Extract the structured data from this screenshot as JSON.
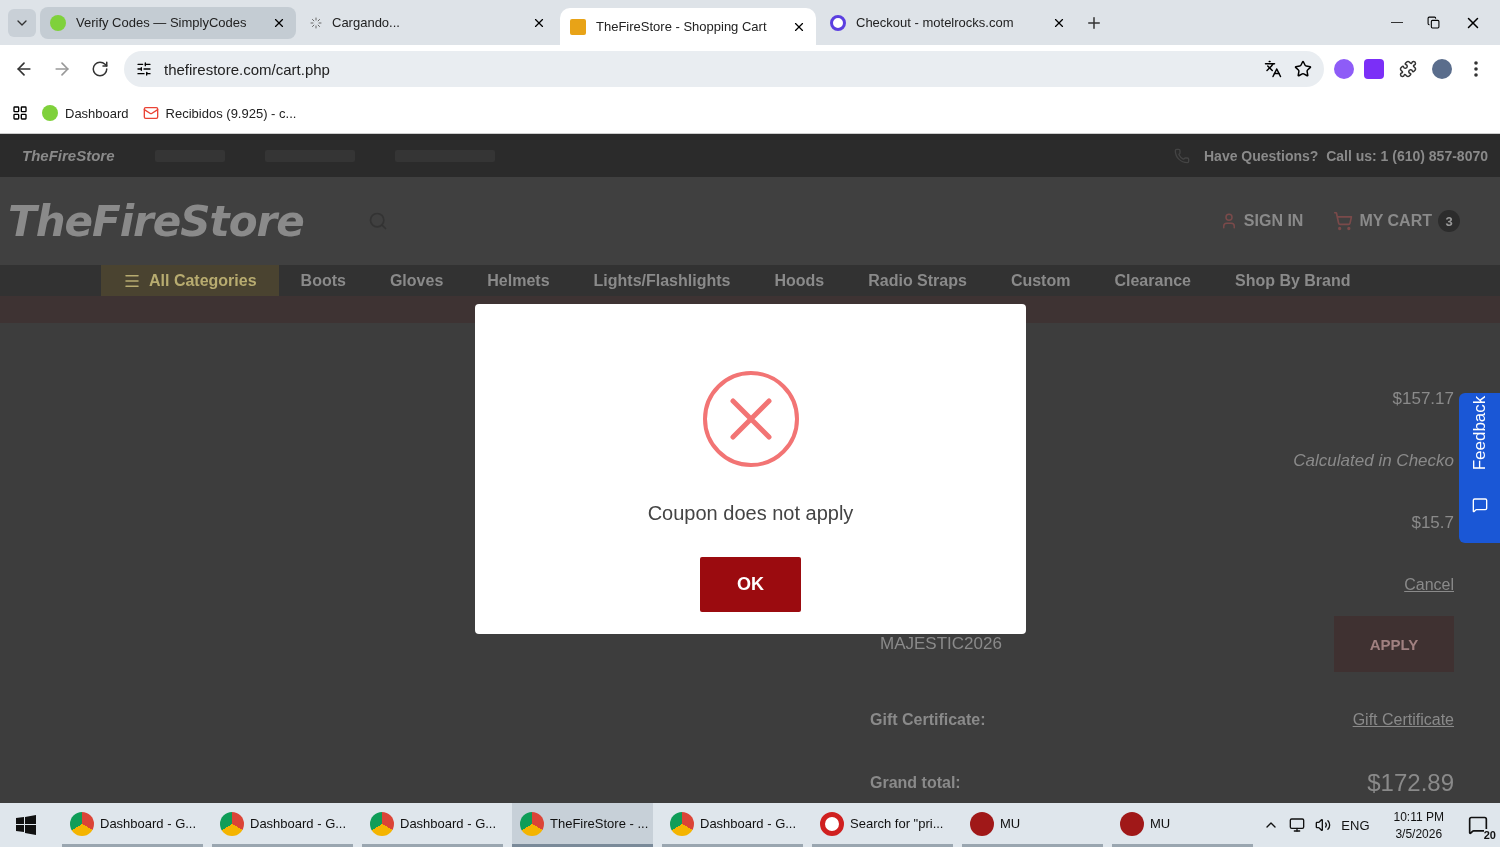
{
  "browser": {
    "tabs": [
      {
        "title": "Verify Codes — SimplyCodes",
        "selected": false,
        "kind": "simply"
      },
      {
        "title": "Cargando...",
        "selected": false,
        "kind": "loading"
      },
      {
        "title": "TheFireStore - Shopping Cart",
        "selected": true,
        "kind": "fire"
      },
      {
        "title": "Checkout - motelrocks.com",
        "selected": false,
        "kind": "ring"
      }
    ],
    "url": "thefirestore.com/cart.php",
    "bookmarks": [
      {
        "label": "Dashboard",
        "kind": "simply"
      },
      {
        "label": "Recibidos (9.925) - c...",
        "kind": "mail"
      }
    ]
  },
  "page": {
    "topbar": {
      "brand": "TheFireStore",
      "phone": "Have Questions?  Call us: 1 (610) 857-8070"
    },
    "header": {
      "logo": "TheFireStore",
      "sign_in": "SIGN IN",
      "cart": "MY CART",
      "cart_count": "3"
    },
    "nav": [
      {
        "label": "All Categories",
        "selected": true
      },
      {
        "label": "Boots",
        "selected": false
      },
      {
        "label": "Gloves",
        "selected": false
      },
      {
        "label": "Helmets",
        "selected": false
      },
      {
        "label": "Lights/Flashlights",
        "selected": false
      },
      {
        "label": "Hoods",
        "selected": false
      },
      {
        "label": "Radio Straps",
        "selected": false
      },
      {
        "label": "Custom",
        "selected": false
      },
      {
        "label": "Clearance",
        "selected": false
      },
      {
        "label": "Shop By Brand",
        "selected": false
      }
    ],
    "summary": [
      {
        "kind": "value",
        "value": "$157.17"
      },
      {
        "kind": "note",
        "value": "Calculated in Checko"
      },
      {
        "kind": "value",
        "value": "$15.7"
      },
      {
        "kind": "link",
        "value": "Cancel"
      },
      {
        "kind": "coupon",
        "code": "MAJESTIC2026",
        "button": "APPLY"
      },
      {
        "kind": "labeled_link",
        "label": "Gift Certificate:",
        "value": "Gift Certificate"
      },
      {
        "kind": "total",
        "label": "Grand total:",
        "value": "$172.89"
      }
    ],
    "feedback": "Feedback",
    "modal": {
      "message": "Coupon does not apply",
      "button": "OK"
    }
  },
  "taskbar": {
    "items": [
      {
        "label": "Dashboard - G...",
        "selected": false,
        "kind": "chrome"
      },
      {
        "label": "Dashboard - G...",
        "selected": false,
        "kind": "chrome"
      },
      {
        "label": "Dashboard - G...",
        "selected": false,
        "kind": "chrome"
      },
      {
        "label": "TheFireStore - ...",
        "selected": true,
        "kind": "chrome"
      },
      {
        "label": "Dashboard - G...",
        "selected": false,
        "kind": "chrome"
      },
      {
        "label": "Search for \"pri...",
        "selected": false,
        "kind": "opera"
      },
      {
        "label": "MU",
        "selected": false,
        "kind": "game"
      },
      {
        "label": "MU",
        "selected": false,
        "kind": "game"
      }
    ],
    "language": "ENG",
    "time": "10:11 PM",
    "date": "3/5/2026",
    "notifications": "20"
  }
}
